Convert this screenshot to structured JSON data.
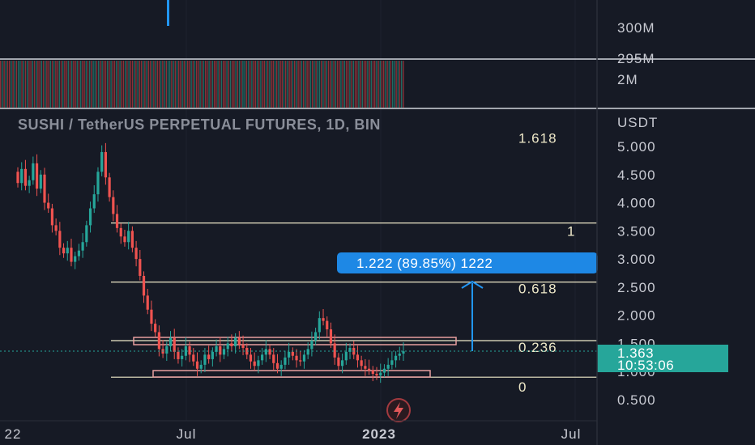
{
  "chart_data": {
    "type": "candlestick",
    "title": "SUSHI / TetherUS PERPETUAL FUTURES, 1D, BIN",
    "currency": "USDT",
    "y_ticks": [
      "5.000",
      "4.500",
      "4.000",
      "3.500",
      "3.000",
      "2.500",
      "2.000",
      "1.500",
      "1.000",
      "0.500"
    ],
    "x_ticks": [
      "22",
      "Jul",
      "2023",
      "Jul"
    ],
    "volume_pane": {
      "labels": [
        "300M",
        "295M",
        "2M"
      ]
    },
    "fib_levels": [
      {
        "label": "1.618",
        "price": 5.15
      },
      {
        "label": "1",
        "price": 3.64
      },
      {
        "label": "0.618",
        "price": 2.59
      },
      {
        "label": "0.236",
        "price": 1.55
      },
      {
        "label": "0",
        "price": 0.9
      }
    ],
    "measure": {
      "label": "1.222 (89.85%) 1222",
      "from": 1.36,
      "to": 2.59
    },
    "current_price": "1.363",
    "countdown": "10:53:06",
    "colors": {
      "up": "#26a69a",
      "down": "#ef5350",
      "fib": "#efe9c9",
      "measure": "#2196f3",
      "price_tag": "#26a69a",
      "zone": "#e8a0a0"
    },
    "close_series": [
      4.35,
      4.6,
      4.3,
      4.4,
      4.7,
      4.25,
      4.5,
      4.0,
      3.9,
      3.6,
      3.5,
      3.2,
      3.1,
      3.2,
      2.95,
      3.05,
      3.15,
      3.3,
      3.6,
      3.9,
      4.15,
      4.55,
      4.9,
      4.45,
      4.1,
      3.8,
      3.55,
      3.4,
      3.3,
      3.5,
      3.2,
      3.0,
      2.7,
      2.35,
      2.1,
      1.85,
      1.7,
      1.4,
      1.32,
      1.45,
      1.6,
      1.35,
      1.22,
      1.28,
      1.45,
      1.3,
      1.18,
      1.05,
      1.12,
      1.3,
      1.22,
      1.35,
      1.45,
      1.3,
      1.4,
      1.5,
      1.45,
      1.6,
      1.48,
      1.42,
      1.3,
      1.18,
      1.1,
      1.2,
      1.3,
      1.4,
      1.3,
      1.15,
      1.05,
      1.12,
      1.25,
      1.35,
      1.28,
      1.2,
      1.18,
      1.3,
      1.4,
      1.55,
      1.7,
      1.95,
      1.9,
      1.75,
      1.5,
      1.25,
      1.1,
      1.2,
      1.35,
      1.42,
      1.3,
      1.2,
      1.1,
      1.05,
      1.02,
      0.96,
      0.93,
      0.98,
      1.05,
      1.12,
      1.2,
      1.28,
      1.32,
      1.36
    ]
  }
}
